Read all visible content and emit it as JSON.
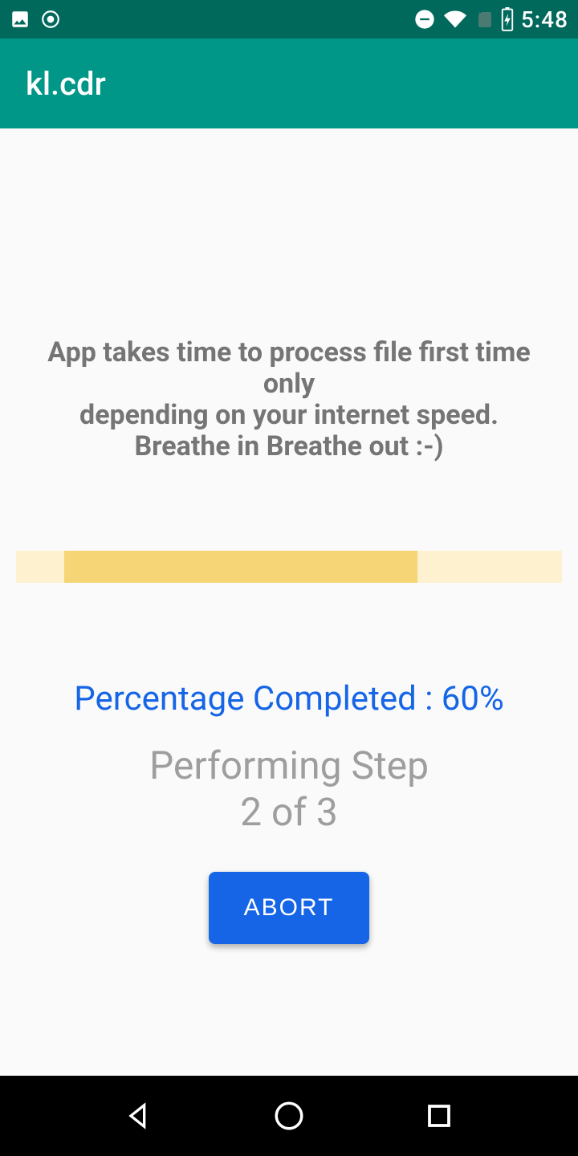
{
  "status_bar": {
    "time": "5:48"
  },
  "app_bar": {
    "title": "kl.cdr"
  },
  "content": {
    "info_line1": "App takes time to process file first time only",
    "info_line2": "depending on your internet speed.",
    "info_line3": "Breathe in Breathe out :-)",
    "percentage_label": "Percentage Completed : 60%",
    "step_line1": "Performing Step",
    "step_line2": "2 of 3",
    "abort_label": "ABORT",
    "progress_percent": 60,
    "current_step": 2,
    "total_steps": 3
  }
}
